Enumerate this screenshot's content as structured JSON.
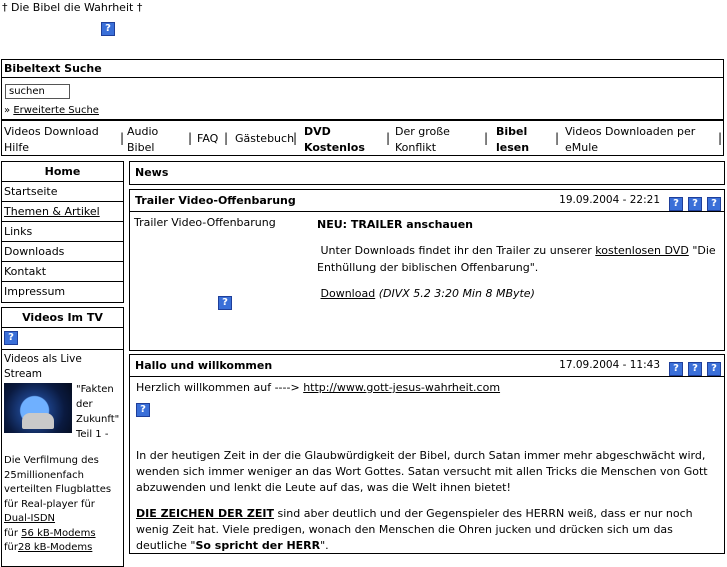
{
  "page": {
    "title": "† Die Bibel die Wahrheit †"
  },
  "search": {
    "header": "Bibeltext Suche",
    "input_value": "suchen",
    "advanced_prefix": "»",
    "advanced_link": "Erweiterte Suche"
  },
  "nav": {
    "items": [
      {
        "label_1": "Videos Download",
        "label_2": "Hilfe"
      },
      {
        "label_1": "Audio",
        "label_2": "Bibel"
      },
      {
        "label_1": "FAQ"
      },
      {
        "label_1": "Gästebuch"
      },
      {
        "label_1": "DVD",
        "label_2": "Kostenlos"
      },
      {
        "label_1": "Der große",
        "label_2": "Konflikt"
      },
      {
        "label_1": "Bibel",
        "label_2": "lesen"
      },
      {
        "label_1": "Videos Downloaden per",
        "label_2": "eMule"
      }
    ],
    "separator": "|"
  },
  "menu": {
    "header": "Home",
    "items": [
      "Startseite",
      "Themen & Artikel",
      "Links",
      "Downloads",
      "Kontakt",
      "Impressum"
    ]
  },
  "tv": {
    "header": "Videos Im TV",
    "live_stream": "Videos als Live Stream",
    "caption": "\"Fakten der Zukunft\" Teil 1 -",
    "text_1": "Die Verfilmung des 25millionenfach verteilten Flugblattes für Real-player für",
    "link_isdn": "Dual-ISDN",
    "text_fuer": "für",
    "link_56k": "56 kB-Modems",
    "link_28k": "28 kB-Modems"
  },
  "news": {
    "header": "News",
    "articles": [
      {
        "title": "Trailer Video-Offenbarung",
        "date": "19.09.2004 - 22:21",
        "left_label": "Trailer Video-Offenbarung",
        "headline": "NEU: TRAILER anschauen",
        "para_pre": "Unter Downloads findet ihr den Trailer zu unserer",
        "para_link": "kostenlosen DVD",
        "para_post": "\"Die Enthüllung der biblischen Offenbarung\".",
        "download_link": "Download",
        "download_info": "(DIVX 5.2 3:20 Min 8 MByte)"
      },
      {
        "title": "Hallo und willkommen",
        "date": "17.09.2004 - 11:43",
        "welcome_pre": "Herzlich willkommen auf ----> ",
        "welcome_link": "http://www.gott-jesus-wahrheit.com",
        "para_1": "In der heutigen Zeit in der die Glaubwürdigkeit der Bibel, durch Satan immer mehr abgeschwächt wird, wenden sich immer weniger an das Wort Gottes. Satan versucht mit allen Tricks die Menschen von Gott abzuwenden und lenkt die Leute auf das, was die Welt ihnen bietet!",
        "para_2_link": "DIE ZEICHEN DER ZEIT",
        "para_2_mid": " sind aber deutlich und der Gegenspieler des HERRN weiß, dass er nur noch wenig Zeit hat. Viele predigen, wonach den Menschen die Ohren jucken und drücken sich um das deutliche \"",
        "para_2_bold": "So spricht der HERR",
        "para_2_end": "\"."
      }
    ]
  },
  "icon_glyph": "?",
  "colors": {
    "icon_blue": "#3a6fd8"
  }
}
